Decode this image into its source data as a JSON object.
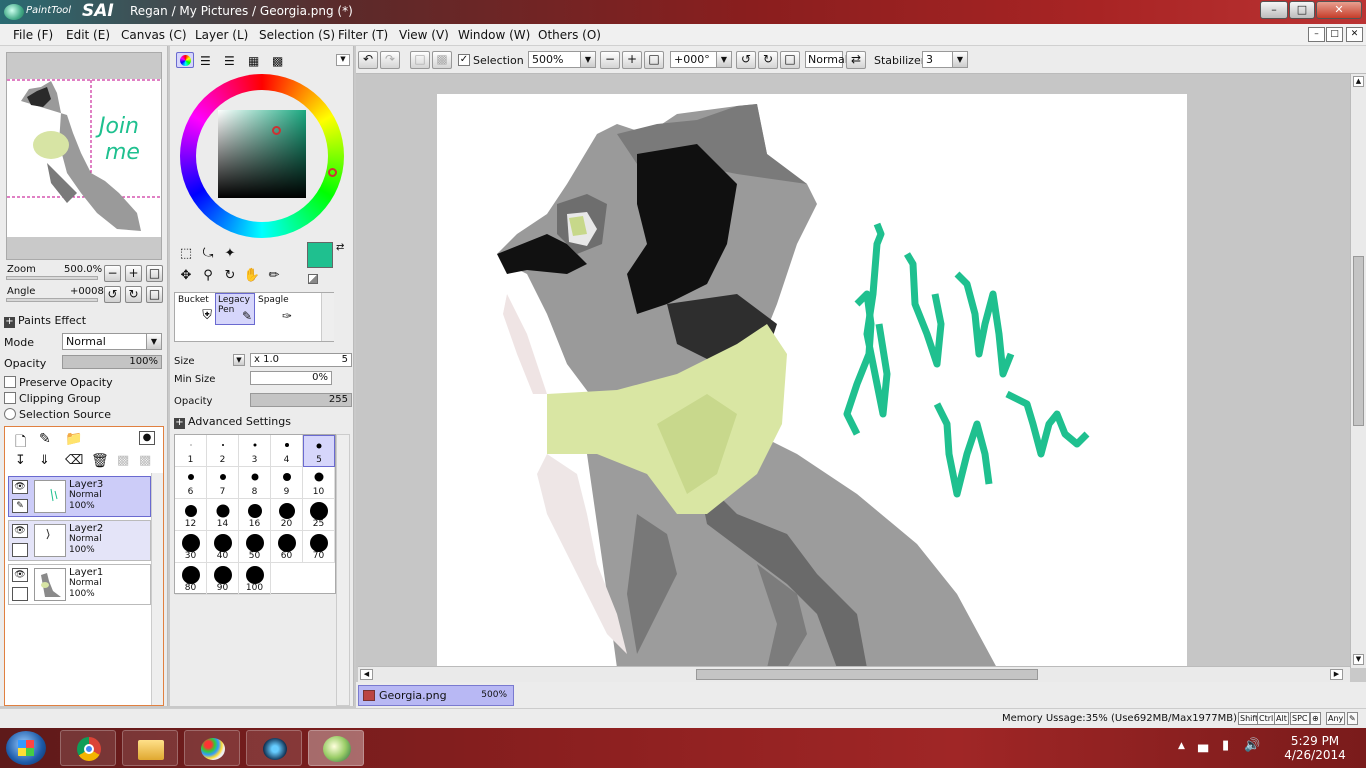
{
  "window": {
    "app_logo_text": "PaintTool",
    "app_logo_big": "SAI",
    "title": "Regan / My Pictures / Georgia.png (*)",
    "min_glyph": "–",
    "max_glyph": "□",
    "close_glyph": "✕"
  },
  "menu": {
    "items": [
      "File (F)",
      "Edit (E)",
      "Canvas (C)",
      "Layer (L)",
      "Selection (S)",
      "Filter (T)",
      "View (V)",
      "Window (W)",
      "Others (O)"
    ],
    "mdi": [
      "–",
      "□",
      "✕"
    ]
  },
  "navigator": {
    "zoom_label": "Zoom",
    "zoom_value": "500.0%",
    "angle_label": "Angle",
    "angle_value": "+0008"
  },
  "paints_effect": {
    "header": "Paints Effect",
    "mode_label": "Mode",
    "mode_value": "Normal",
    "opacity_label": "Opacity",
    "opacity_value": "100%",
    "preserve_opacity": "Preserve Opacity",
    "clipping_group": "Clipping Group",
    "selection_source": "Selection Source"
  },
  "layers": [
    {
      "name": "Layer3",
      "mode": "Normal",
      "opacity": "100%"
    },
    {
      "name": "Layer2",
      "mode": "Normal",
      "opacity": "100%"
    },
    {
      "name": "Layer1",
      "mode": "Normal",
      "opacity": "100%"
    }
  ],
  "colors": {
    "primary": "#1fc08f",
    "secondary": "#ffffff",
    "accent_select": "#d6d6fb"
  },
  "tools": {
    "bucket": "Bucket",
    "legacy_pen_1": "Legacy",
    "legacy_pen_2": "Pen",
    "spagle": "Spagle"
  },
  "brush": {
    "size_label": "Size",
    "size_mult": "x 1.0",
    "size_value": "5",
    "min_size_label": "Min Size",
    "min_size_value": "0%",
    "opacity_label": "Opacity",
    "opacity_value": "255",
    "advanced": "Advanced Settings",
    "sizes": [
      "1",
      "2",
      "3",
      "4",
      "5",
      "6",
      "7",
      "8",
      "9",
      "10",
      "12",
      "14",
      "16",
      "20",
      "25",
      "30",
      "40",
      "50",
      "60",
      "70",
      "80",
      "90",
      "100"
    ]
  },
  "toolbar": {
    "selection_label": "Selection",
    "zoom_value": "500%",
    "angle_value": "+000°",
    "mode_value": "Normal",
    "stabilizer_label": "Stabilizer",
    "stabilizer_value": "3"
  },
  "document_tab": {
    "name": "Georgia.png",
    "zoom": "500%"
  },
  "status": {
    "memory": "Memory Ussage:35% (Use692MB/Max1977MB)",
    "keys": [
      "Shift",
      "Ctrl",
      "Alt",
      "SPC",
      "⊕",
      "Any",
      "✎"
    ]
  },
  "taskbar": {
    "time": "5:29 PM",
    "date": "4/26/2014"
  }
}
